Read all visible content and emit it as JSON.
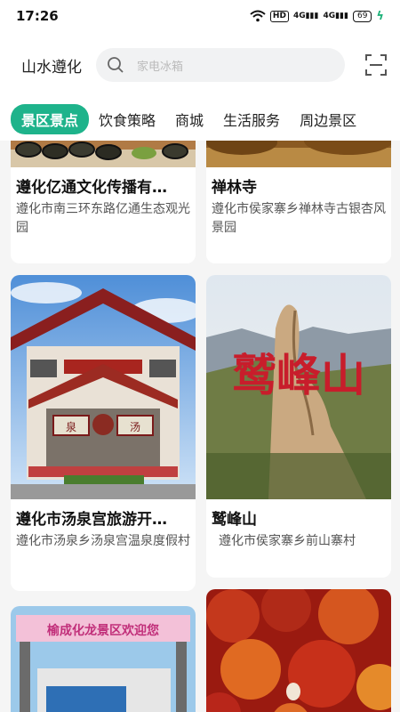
{
  "status": {
    "time": "17:26",
    "network": "4G",
    "hd": "HD",
    "battery": "69"
  },
  "header": {
    "title": "山水遵化",
    "search_placeholder": "家电冰箱"
  },
  "tabs": [
    {
      "label": "景区景点",
      "active": true
    },
    {
      "label": "饮食策略",
      "active": false
    },
    {
      "label": "商城",
      "active": false
    },
    {
      "label": "生活服务",
      "active": false
    },
    {
      "label": "周边景区",
      "active": false
    }
  ],
  "cards": [
    {
      "title": "遵化亿通文化传播有…",
      "address": "遵化市南三环东路亿通生态观光园"
    },
    {
      "title": "禅林寺",
      "address": "遵化市侯家寨乡禅林寺古银杏风景园"
    },
    {
      "title": "遵化市汤泉宫旅游开…",
      "address": "遵化市汤泉乡汤泉宫温泉度假村",
      "sign_left": "泉",
      "sign_right": "汤"
    },
    {
      "title": "鹫峰山",
      "address": "遵化市侯家寨乡前山寨村",
      "calligraphy": "鹫峰山"
    },
    {
      "title": "",
      "address": "",
      "banner": "榆成化龙景区欢迎您"
    },
    {
      "title": "",
      "address": ""
    }
  ],
  "colors": {
    "accent": "#1eb38b"
  }
}
